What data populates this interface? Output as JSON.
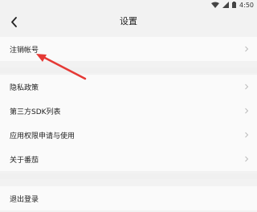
{
  "status_bar": {
    "time": "4:50",
    "icons": [
      "wifi-icon",
      "signal-icon",
      "battery-icon"
    ]
  },
  "header": {
    "title": "设置",
    "back_icon": "back-chevron-icon"
  },
  "rows": {
    "deactivate": "注销帐号",
    "privacy": "隐私政策",
    "sdk_list": "第三方SDK列表",
    "permissions": "应用权限申请与使用",
    "about": "关于番茄",
    "logout": "退出登录"
  },
  "annotation": {
    "arrow_color": "#e53935"
  }
}
